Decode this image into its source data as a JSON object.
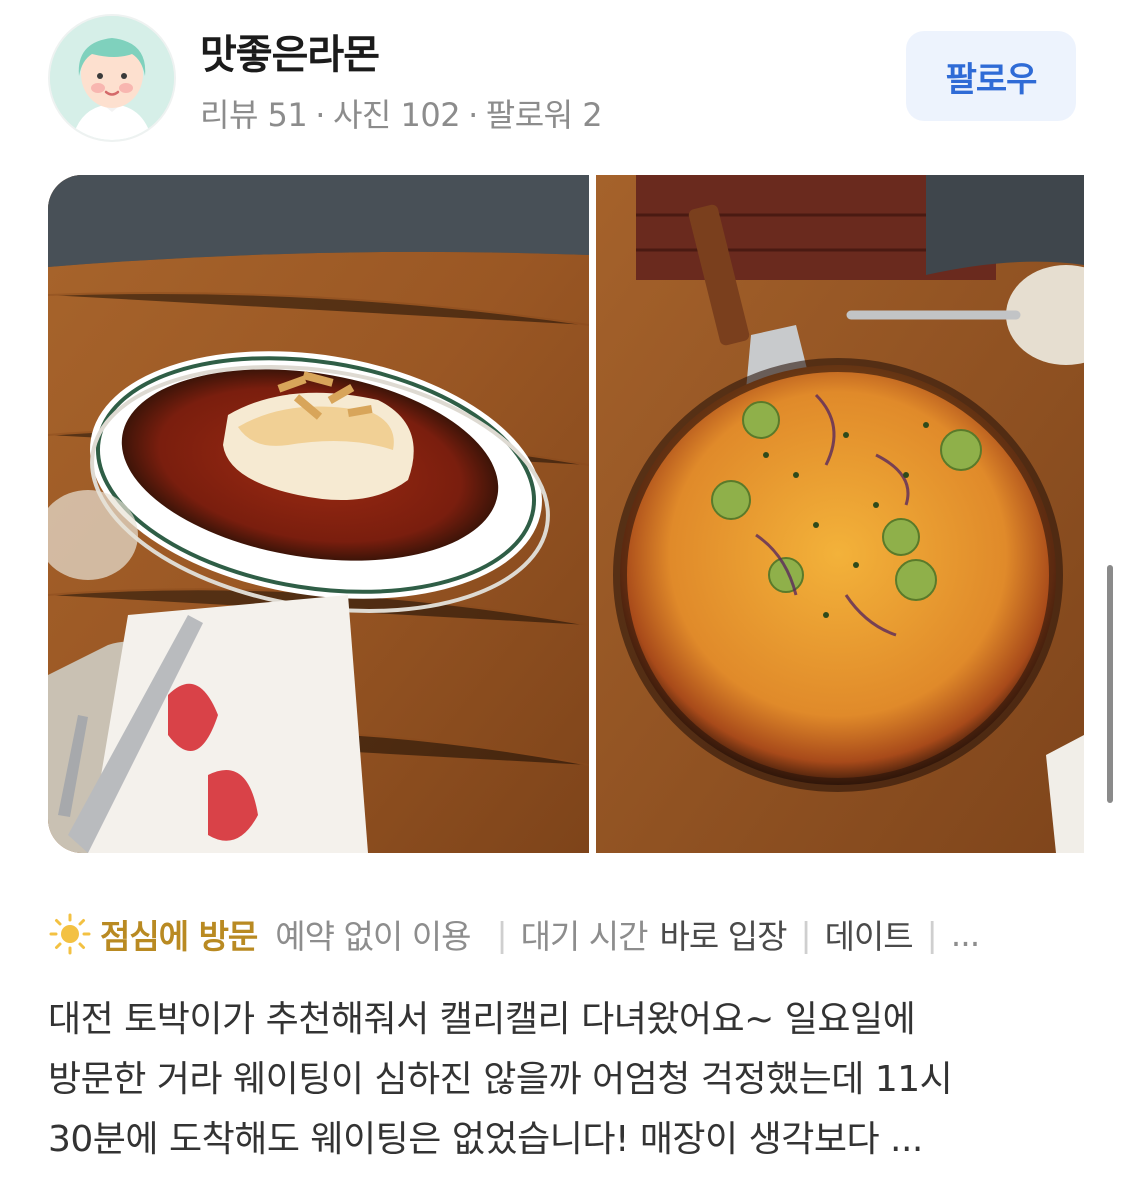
{
  "profile": {
    "username": "맛좋은라몬",
    "stats": {
      "reviews": "리뷰 51",
      "photos": "사진 102",
      "followers": "팔로워 2",
      "separator": "·"
    },
    "follow_label": "팔로우"
  },
  "photos": [
    {
      "icon": "lasagna-photo"
    },
    {
      "icon": "pizza-photo"
    }
  ],
  "visit_tags": {
    "meal": "점심에 방문",
    "reservation_key": "예약 없이 이용",
    "wait_key": "대기 시간",
    "wait_value": "바로 입장",
    "purpose": "데이트",
    "separator": "|",
    "more": "..."
  },
  "review": {
    "line1": "대전 토박이가 추천해줘서 캘리캘리 다녀왔어요~ 일요일에",
    "line2": "방문한 거라 웨이팅이 심하진 않을까 어엄청 걱정했는데 11시",
    "line3": "30분에 도착해도 웨이팅은 없었습니다! 매장이 생각보다 ..."
  },
  "colors": {
    "accent_blue": "#2f6bd6",
    "follow_bg": "#edf3fd",
    "meal_gold": "#b98a22"
  }
}
